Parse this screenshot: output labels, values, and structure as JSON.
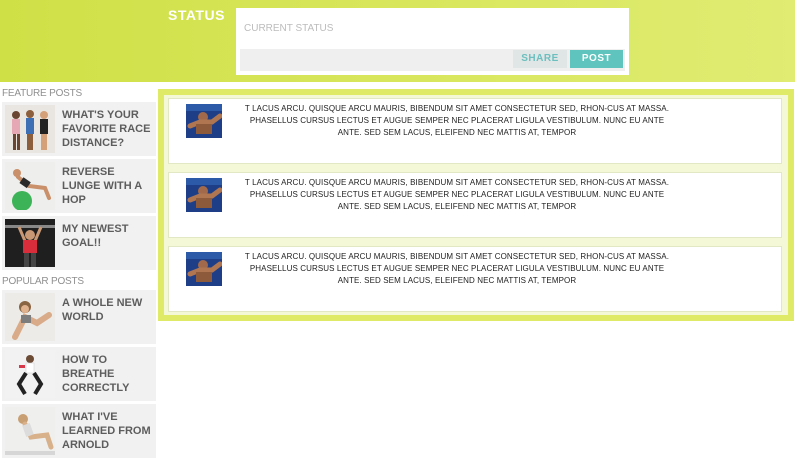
{
  "status": {
    "title": "STATUS",
    "placeholder": "CURRENT STATUS",
    "share_label": "SHARE",
    "post_label": "POST"
  },
  "sidebar": {
    "feature_title": "FEATURE POSTS",
    "feature_posts": [
      {
        "label": "WHAT'S YOUR FAVORITE RACE DISTANCE?"
      },
      {
        "label": "REVERSE LUNGE WITH A HOP"
      },
      {
        "label": "MY NEWEST GOAL!!"
      }
    ],
    "popular_title": "POPULAR POSTS",
    "popular_posts": [
      {
        "label": "A WHOLE NEW WORLD"
      },
      {
        "label": "HOW TO BREATHE CORRECTLY"
      },
      {
        "label": "WHAT I'VE LEARNED FROM ARNOLD"
      }
    ]
  },
  "feed": {
    "items": [
      {
        "text": "T LACUS ARCU. QUISQUE ARCU MAURIS, BIBENDUM SIT AMET CONSECTETUR SED, RHON-CUS AT MASSA. PHASELLUS CURSUS LECTUS ET AUGUE SEMPER NEC PLACERAT LIGULA VESTIBULUM. NUNC EU ANTE ANTE. SED SEM LACUS, ELEIFEND NEC MATTIS AT, TEMPOR"
      },
      {
        "text": "T LACUS ARCU. QUISQUE ARCU MAURIS, BIBENDUM SIT AMET CONSECTETUR SED, RHON-CUS AT MASSA. PHASELLUS CURSUS LECTUS ET AUGUE SEMPER NEC PLACERAT LIGULA VESTIBULUM. NUNC EU ANTE ANTE. SED SEM LACUS, ELEIFEND NEC MATTIS AT, TEMPOR"
      },
      {
        "text": "T LACUS ARCU. QUISQUE ARCU MAURIS, BIBENDUM SIT AMET CONSECTETUR SED, RHON-CUS AT MASSA. PHASELLUS CURSUS LECTUS ET AUGUE SEMPER NEC PLACERAT LIGULA VESTIBULUM. NUNC EU ANTE ANTE. SED SEM LACUS, ELEIFEND NEC MATTIS AT, TEMPOR"
      }
    ]
  },
  "colors": {
    "accent_green": "#d4e455",
    "post_teal": "#5fc4bd",
    "share_text": "#6bbfbe"
  }
}
